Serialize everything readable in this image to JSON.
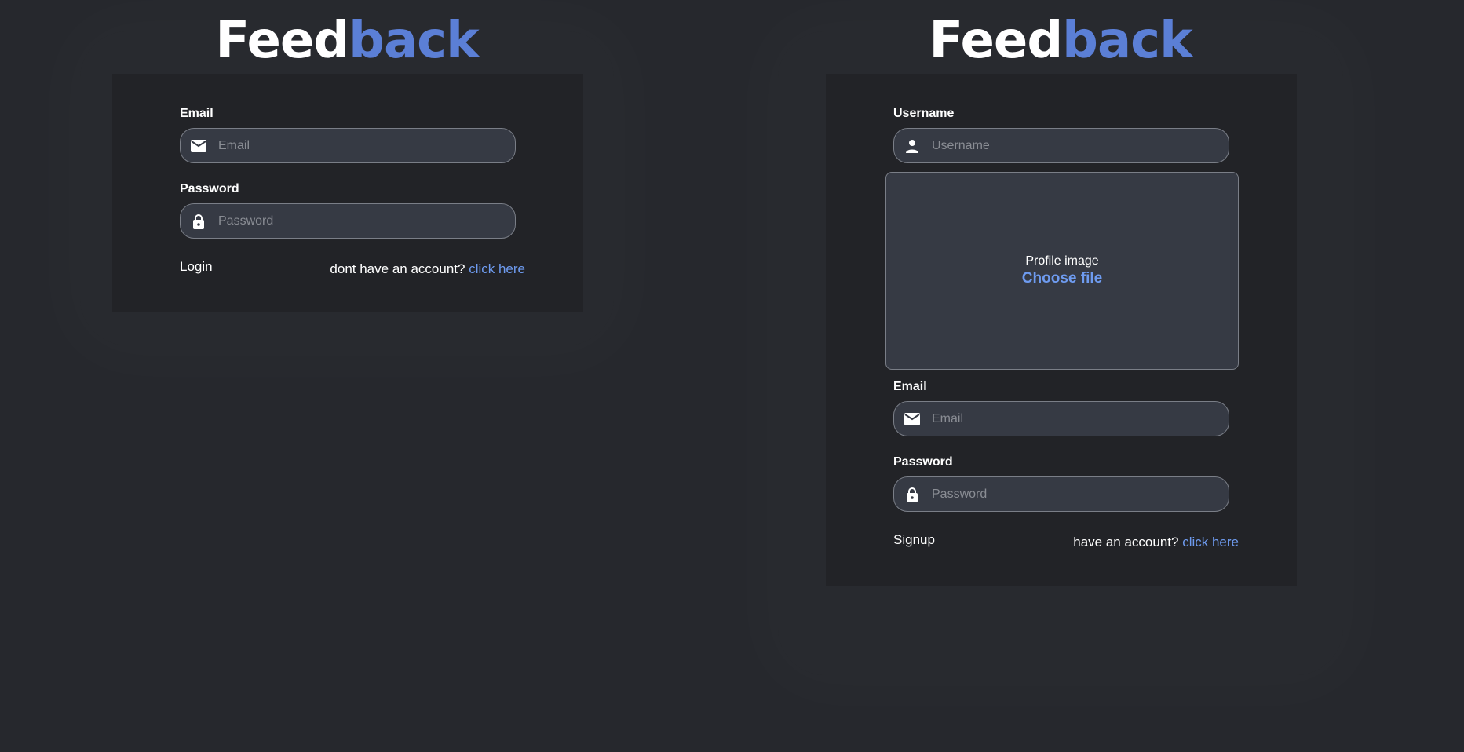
{
  "login": {
    "logo": {
      "part1": "Feed",
      "part2": "back"
    },
    "email": {
      "label": "Email",
      "placeholder": "Email",
      "icon": "mail-icon"
    },
    "password": {
      "label": "Password",
      "placeholder": "Password",
      "icon": "lock-icon"
    },
    "submit_label": "Login",
    "alt_text": "dont have an account?",
    "alt_link": "click here"
  },
  "signup": {
    "logo": {
      "part1": "Feed",
      "part2": "back"
    },
    "username": {
      "label": "Username",
      "placeholder": "Username",
      "icon": "user-icon"
    },
    "profile_image": {
      "label": "Profile image",
      "button": "Choose file"
    },
    "email": {
      "label": "Email",
      "placeholder": "Email",
      "icon": "mail-icon"
    },
    "password": {
      "label": "Password",
      "placeholder": "Password",
      "icon": "lock-icon"
    },
    "submit_label": "Signup",
    "alt_text": "have an account?",
    "alt_link": "click here"
  },
  "colors": {
    "accent": "#5b7fd6",
    "link": "#6e9bf0",
    "background": "#26282d",
    "card": "#222327",
    "field": "#363a44"
  }
}
